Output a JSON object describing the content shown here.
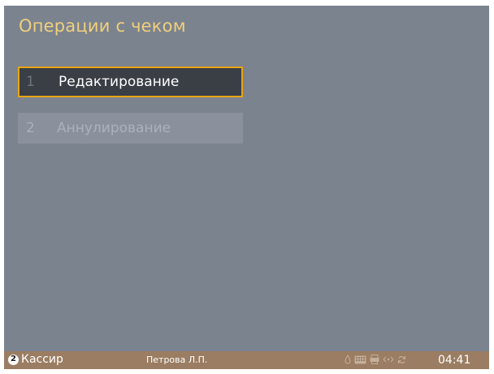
{
  "screen": {
    "title": "Операции с чеком"
  },
  "menu": {
    "items": [
      {
        "number": "1",
        "label": "Редактирование",
        "state": "selected"
      },
      {
        "number": "2",
        "label": "Аннулирование",
        "state": "disabled"
      }
    ]
  },
  "statusbar": {
    "role_number": "2",
    "role": "Кассир",
    "user": "Петрова Л.П.",
    "time": "04:41",
    "icons": [
      "drop-icon",
      "keyboard-icon",
      "printer-icon",
      "network-icon",
      "sync-icon"
    ]
  },
  "colors": {
    "background": "#7b838f",
    "title": "#f0cf7c",
    "selected_border": "#e8a514",
    "selected_fill": "#3a3f46",
    "statusbar": "#9a7d62"
  }
}
